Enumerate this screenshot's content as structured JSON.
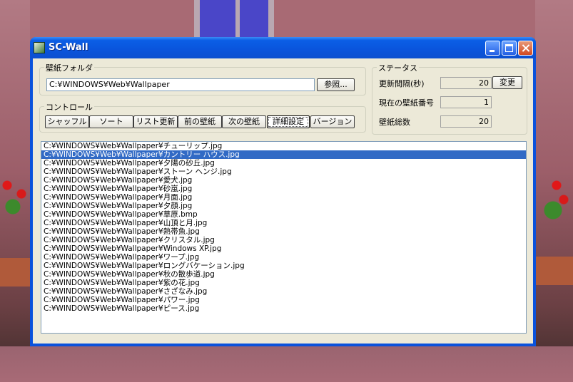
{
  "window": {
    "title": "SC-Wall"
  },
  "folder_group": {
    "label": "壁紙フォルダ",
    "path": "C:¥WINDOWS¥Web¥Wallpaper",
    "browse_label": "参照..."
  },
  "control_group": {
    "label": "コントロール",
    "buttons": [
      "シャッフル",
      "ソート",
      "リスト更新",
      "前の壁紙",
      "次の壁紙",
      "詳細設定",
      "バージョン"
    ]
  },
  "status_group": {
    "label": "ステータス",
    "interval_label": "更新間隔(秒)",
    "interval_value": "20",
    "change_label": "変更",
    "current_label": "現在の壁紙番号",
    "current_value": "1",
    "total_label": "壁紙総数",
    "total_value": "20"
  },
  "file_list": {
    "selected_index": 1,
    "items": [
      "C:¥WINDOWS¥Web¥Wallpaper¥チューリップ.jpg",
      "C:¥WINDOWS¥Web¥Wallpaper¥カントリー ハウス.jpg",
      "C:¥WINDOWS¥Web¥Wallpaper¥夕陽の砂丘.jpg",
      "C:¥WINDOWS¥Web¥Wallpaper¥ストーン ヘンジ.jpg",
      "C:¥WINDOWS¥Web¥Wallpaper¥愛犬.jpg",
      "C:¥WINDOWS¥Web¥Wallpaper¥砂嵐.jpg",
      "C:¥WINDOWS¥Web¥Wallpaper¥月面.jpg",
      "C:¥WINDOWS¥Web¥Wallpaper¥夕顔.jpg",
      "C:¥WINDOWS¥Web¥Wallpaper¥草原.bmp",
      "C:¥WINDOWS¥Web¥Wallpaper¥山頂と月.jpg",
      "C:¥WINDOWS¥Web¥Wallpaper¥熱帯魚.jpg",
      "C:¥WINDOWS¥Web¥Wallpaper¥クリスタル.jpg",
      "C:¥WINDOWS¥Web¥Wallpaper¥Windows XP.jpg",
      "C:¥WINDOWS¥Web¥Wallpaper¥ワープ.jpg",
      "C:¥WINDOWS¥Web¥Wallpaper¥ロングバケーション.jpg",
      "C:¥WINDOWS¥Web¥Wallpaper¥秋の散歩道.jpg",
      "C:¥WINDOWS¥Web¥Wallpaper¥紫の花.jpg",
      "C:¥WINDOWS¥Web¥Wallpaper¥さざなみ.jpg",
      "C:¥WINDOWS¥Web¥Wallpaper¥パワー.jpg",
      "C:¥WINDOWS¥Web¥Wallpaper¥ピース.jpg"
    ]
  }
}
